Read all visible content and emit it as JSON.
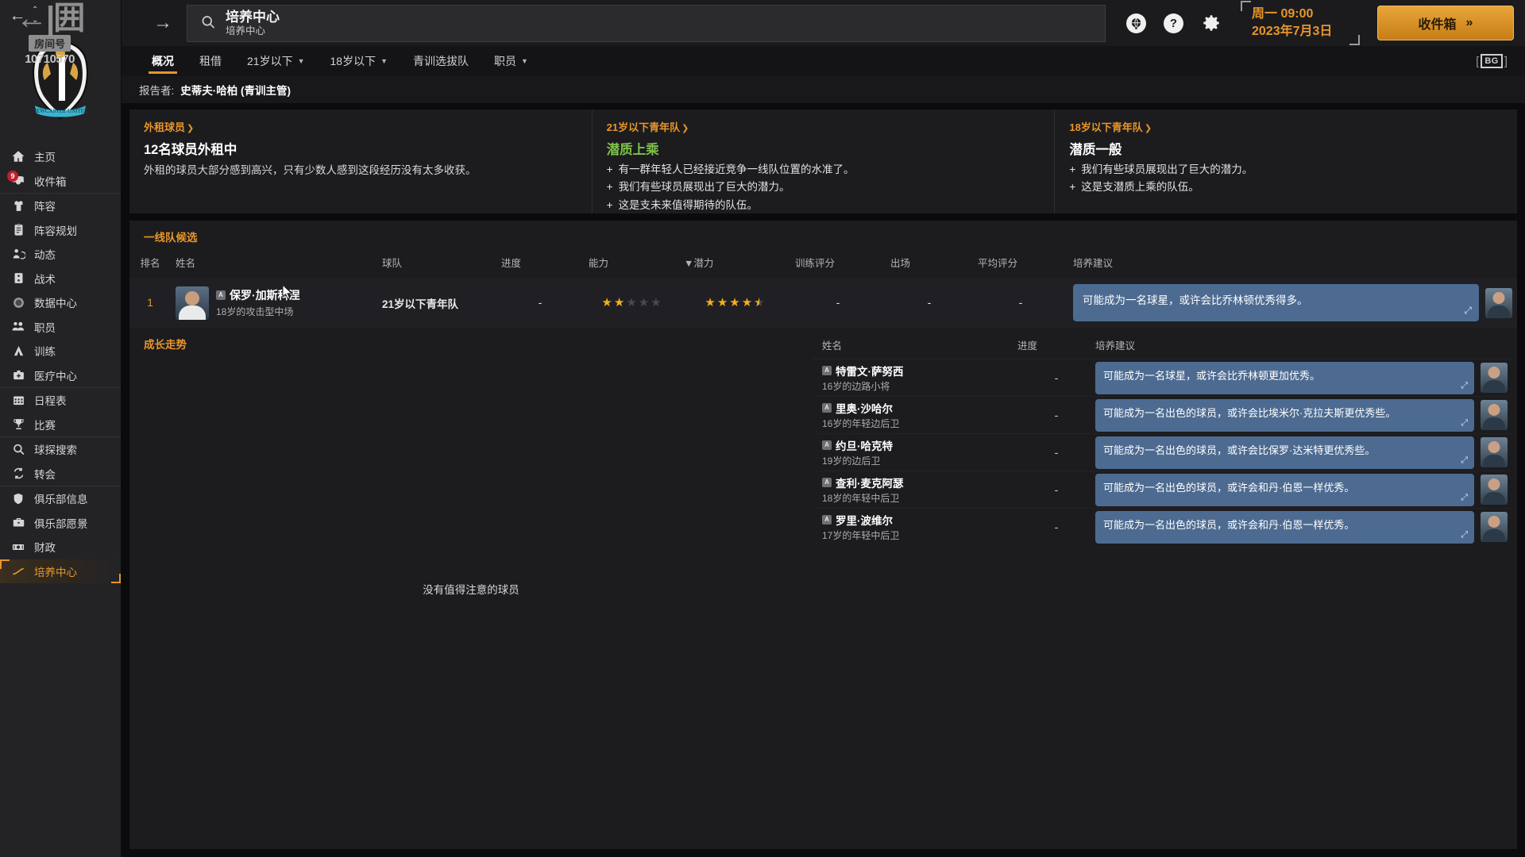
{
  "watermark": {
    "big": "←|囲",
    "room_label": "房间号",
    "number": "10710570"
  },
  "topbar": {
    "back_icon": "back-arrow-icon",
    "forward_icon": "forward-arrow-icon",
    "search": {
      "icon": "search-icon",
      "title": "培养中心",
      "subtitle": "培养中心",
      "placeholder": "培养中心"
    },
    "globe_icon": "globe-icon",
    "help_icon": "help-icon",
    "settings_icon": "gear-icon",
    "date": {
      "line1": "周一 09:00",
      "line2": "2023年7月3日"
    },
    "inbox_button": {
      "label": "收件箱",
      "chevron": "»"
    }
  },
  "tabs": [
    {
      "label": "概况",
      "active": true,
      "has_caret": false
    },
    {
      "label": "租借",
      "active": false,
      "has_caret": false
    },
    {
      "label": "21岁以下",
      "active": false,
      "has_caret": true
    },
    {
      "label": "18岁以下",
      "active": false,
      "has_caret": true
    },
    {
      "label": "青训选拔队",
      "active": false,
      "has_caret": false
    },
    {
      "label": "职员",
      "active": false,
      "has_caret": true
    }
  ],
  "brand_logo": {
    "text": "BG"
  },
  "reporter": {
    "label": "报告者:",
    "value": "史蒂夫·哈柏 (青训主管)"
  },
  "sidebar": {
    "groups": [
      {
        "items": [
          {
            "label": "主页",
            "icon": "home-icon",
            "active": false
          },
          {
            "label": "收件箱",
            "icon": "inbox-icon",
            "active": false,
            "badge": "9"
          }
        ]
      },
      {
        "items": [
          {
            "label": "阵容",
            "icon": "shirt-icon",
            "active": false
          },
          {
            "label": "阵容规划",
            "icon": "clipboard-icon",
            "active": false
          },
          {
            "label": "动态",
            "icon": "player-activity-icon",
            "active": false
          },
          {
            "label": "战术",
            "icon": "tactics-icon",
            "active": false
          },
          {
            "label": "数据中心",
            "icon": "data-hub-icon",
            "active": false
          },
          {
            "label": "职员",
            "icon": "staff-icon",
            "active": false
          },
          {
            "label": "训练",
            "icon": "training-icon",
            "active": false
          },
          {
            "label": "医疗中心",
            "icon": "medical-icon",
            "active": false
          }
        ]
      },
      {
        "items": [
          {
            "label": "日程表",
            "icon": "calendar-icon",
            "active": false
          },
          {
            "label": "比赛",
            "icon": "trophy-icon",
            "active": false
          }
        ]
      },
      {
        "items": [
          {
            "label": "球探搜索",
            "icon": "scout-search-icon",
            "active": false
          },
          {
            "label": "转会",
            "icon": "transfer-icon",
            "active": false
          }
        ]
      },
      {
        "items": [
          {
            "label": "俱乐部信息",
            "icon": "shield-icon",
            "active": false
          },
          {
            "label": "俱乐部愿景",
            "icon": "briefcase-icon",
            "active": false
          },
          {
            "label": "财政",
            "icon": "finance-icon",
            "active": false
          },
          {
            "label": "培养中心",
            "icon": "development-icon",
            "active": true
          }
        ]
      }
    ]
  },
  "summary": [
    {
      "link": "外租球员",
      "headline": "12名球员外租中",
      "headline_color": "white",
      "desc": "外租的球员大部分感到高兴，只有少数人感到这段经历没有太多收获。",
      "bullets": []
    },
    {
      "link": "21岁以下青年队",
      "headline": "潜质上乘",
      "headline_color": "green",
      "desc": "",
      "bullets": [
        "有一群年轻人已经接近竞争一线队位置的水准了。",
        "我们有些球员展现出了巨大的潜力。",
        "这是支未来值得期待的队伍。"
      ]
    },
    {
      "link": "18岁以下青年队",
      "headline": "潜质一般",
      "headline_color": "white",
      "desc": "",
      "bullets": [
        "我们有些球员展现出了巨大的潜力。",
        "这是支潜质上乘的队伍。"
      ]
    }
  ],
  "first_team": {
    "title": "一线队候选",
    "columns": [
      "排名",
      "姓名",
      "球队",
      "进度",
      "能力",
      "▼潜力",
      "训练评分",
      "出场",
      "平均评分",
      "培养建议"
    ],
    "rows": [
      {
        "rank": "1",
        "name": "保罗·加斯科涅",
        "subtitle": "18岁的攻击型中场",
        "team": "21岁以下青年队",
        "progress": "-",
        "ability_stars": 2.0,
        "potential_stars": 4.5,
        "training_rating": "-",
        "appearances": "-",
        "avg_rating": "-",
        "advice": "可能成为一名球星，或许会比乔林顿优秀得多。"
      }
    ]
  },
  "growth": {
    "title": "成长走势",
    "empty_text": "没有值得注意的球员",
    "columns": [
      "姓名",
      "进度",
      "培养建议"
    ],
    "rows": [
      {
        "name": "特雷文·萨努西",
        "subtitle": "16岁的边路小将",
        "progress": "-",
        "advice": "可能成为一名球星，或许会比乔林顿更加优秀。"
      },
      {
        "name": "里奥·沙哈尔",
        "subtitle": "16岁的年轻边后卫",
        "progress": "-",
        "advice": "可能成为一名出色的球员，或许会比埃米尔·克拉夫斯更优秀些。"
      },
      {
        "name": "约旦·哈克特",
        "subtitle": "19岁的边后卫",
        "progress": "-",
        "advice": "可能成为一名出色的球员，或许会比保罗·达米特更优秀些。"
      },
      {
        "name": "查利·麦克阿瑟",
        "subtitle": "18岁的年轻中后卫",
        "progress": "-",
        "advice": "可能成为一名出色的球员，或许会和丹·伯恩一样优秀。"
      },
      {
        "name": "罗里·波维尔",
        "subtitle": "17岁的年轻中后卫",
        "progress": "-",
        "advice": "可能成为一名出色的球员，或许会和丹·伯恩一样优秀。"
      }
    ]
  },
  "colors": {
    "accent": "#e8952a",
    "panel_bg": "#1c1c1f",
    "row_bg": "#202024",
    "bubble_bg": "#4d6b91",
    "good_green": "#7dc24a",
    "star_gold": "#f2b01e"
  }
}
